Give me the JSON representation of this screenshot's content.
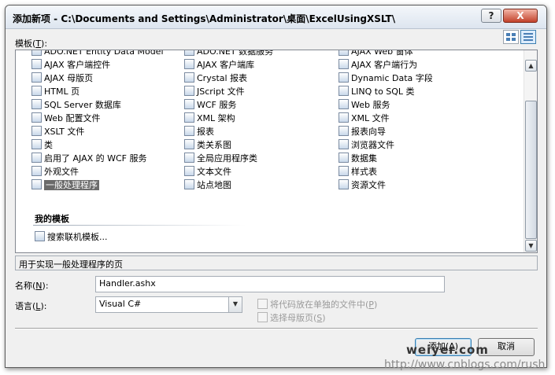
{
  "window": {
    "title": "添加新项 - C:\\Documents and Settings\\Administrator\\桌面\\ExcelUsingXSLT\\"
  },
  "titlebar": {
    "help_label": "?",
    "close_label": "X"
  },
  "templates": {
    "label_prefix": "模板(",
    "label_key": "T",
    "label_suffix": "):",
    "col1": [
      "ADO.NET Entity Data Model",
      "AJAX 客户端控件",
      "AJAX 母版页",
      "HTML 页",
      "SQL Server 数据库",
      "Web 配置文件",
      "XSLT 文件",
      "类",
      "启用了 AJAX 的 WCF 服务",
      "外观文件",
      "一般处理程序"
    ],
    "col2": [
      "ADO.NET 数据服务",
      "AJAX 客户端库",
      "Crystal 报表",
      "JScript 文件",
      "WCF 服务",
      "XML 架构",
      "报表",
      "类关系图",
      "全局应用程序类",
      "文本文件",
      "站点地图"
    ],
    "col3": [
      "AJAX Web 窗体",
      "AJAX 客户端行为",
      "Dynamic Data 字段",
      "LINQ to SQL 类",
      "Web 服务",
      "XML 文件",
      "报表向导",
      "浏览器文件",
      "数据集",
      "样式表",
      "资源文件"
    ],
    "my_templates_heading": "我的模板",
    "search_online": "搜索联机模板..."
  },
  "description": "用于实现一般处理程序的页",
  "name_field": {
    "label_prefix": "名称(",
    "label_key": "N",
    "label_suffix": "):",
    "value": "Handler.ashx"
  },
  "language_field": {
    "label_prefix": "语言(",
    "label_key": "L",
    "label_suffix": "):",
    "value": "Visual C#"
  },
  "options": {
    "separate_file_prefix": "将代码放在单独的文件中(",
    "separate_file_key": "P",
    "separate_file_suffix": ")",
    "master_page_prefix": "选择母版页(",
    "master_page_key": "S",
    "master_page_suffix": ")"
  },
  "buttons": {
    "add_prefix": "添加(",
    "add_key": "A",
    "add_suffix": ")",
    "cancel": "取消"
  },
  "watermark": {
    "line1": "weiyer.com",
    "line2": "http://www.cnblogs.com/rush"
  },
  "colors": {
    "selected_bg": "#6b6b6b",
    "dialog_bg": "#f0f0f0",
    "accent": "#3c7fb1"
  }
}
